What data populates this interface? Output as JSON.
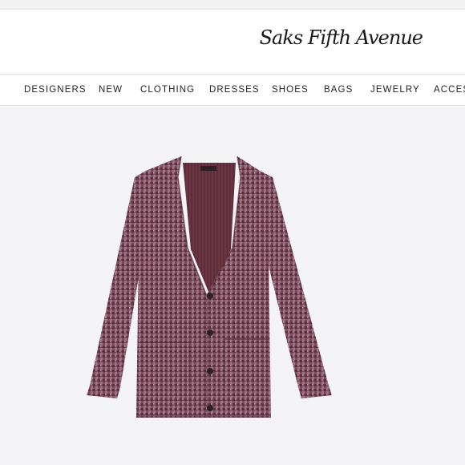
{
  "brand": {
    "logo_text": "Saks Fifth Avenue"
  },
  "nav": {
    "items": [
      {
        "label": "DESIGNERS"
      },
      {
        "label": "NEW"
      },
      {
        "label": "CLOTHING"
      },
      {
        "label": "DRESSES"
      },
      {
        "label": "SHOES"
      },
      {
        "label": "BAGS"
      },
      {
        "label": "JEWELRY"
      },
      {
        "label": "ACCESS"
      }
    ]
  },
  "product": {
    "image_icon": "cardigan-image",
    "colors": {
      "fabric": "#7a4a5a",
      "fabric_dark": "#5a2f3e",
      "lining": "#6b3844",
      "button": "#2a2226",
      "background": "#f4f4f6"
    }
  }
}
